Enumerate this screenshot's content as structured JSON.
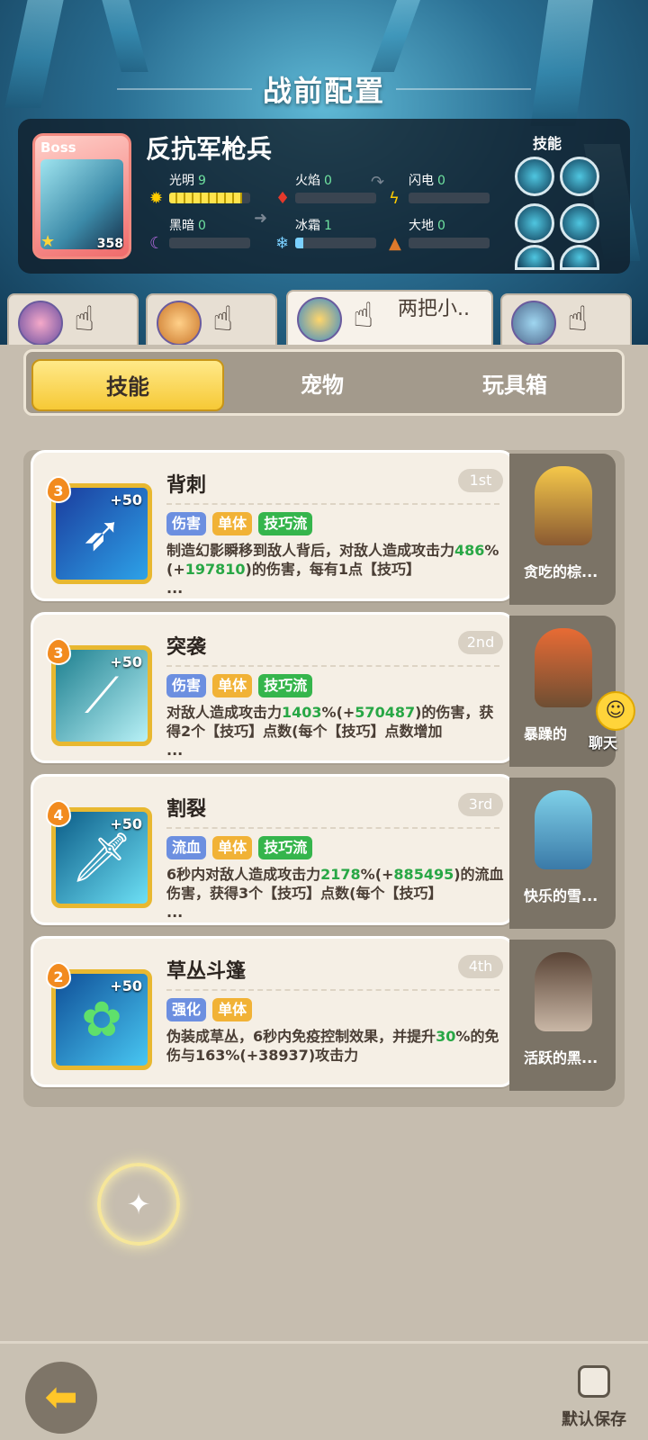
{
  "screen_title": "战前配置",
  "boss": {
    "tag": "Boss",
    "name": "反抗军枪兵",
    "level": "358",
    "elements": [
      {
        "label": "光明",
        "value": "9",
        "fill": 0.9
      },
      {
        "label": "火焰",
        "value": "0",
        "fill": 0
      },
      {
        "label": "闪电",
        "value": "0",
        "fill": 0
      },
      {
        "label": "黑暗",
        "value": "0",
        "fill": 0
      },
      {
        "label": "冰霜",
        "value": "1",
        "fill": 0.1
      },
      {
        "label": "大地",
        "value": "0",
        "fill": 0
      }
    ],
    "skills_label": "技能"
  },
  "team_tabs": [
    {
      "name": ""
    },
    {
      "name": ""
    },
    {
      "name": "两把小.."
    },
    {
      "name": ""
    }
  ],
  "segments": {
    "skill": "技能",
    "pet": "宠物",
    "toybox": "玩具箱"
  },
  "skills": [
    {
      "level": "3",
      "plus": "+50",
      "name": "背刺",
      "rank": "1st",
      "tags": [
        "伤害",
        "单体",
        "技巧流"
      ],
      "desc_a": "制造幻影瞬移到敌人背后，对敌人造成攻击力",
      "pct": "486",
      "pct_bonus": "197810",
      "desc_b": "的伤害，每有1点【技巧】",
      "more": "...",
      "pet_name": "贪吃的棕..."
    },
    {
      "level": "3",
      "plus": "+50",
      "name": "突袭",
      "rank": "2nd",
      "tags": [
        "伤害",
        "单体",
        "技巧流"
      ],
      "desc_a": "对敌人造成攻击力",
      "pct": "1403",
      "pct_bonus": "570487",
      "desc_b": "的伤害，获得2个【技巧】点数(每个【技巧】点数增加",
      "more": "...",
      "pet_name": "暴躁的"
    },
    {
      "level": "4",
      "plus": "+50",
      "name": "割裂",
      "rank": "3rd",
      "tags": [
        "流血",
        "单体",
        "技巧流"
      ],
      "desc_a": "6秒内对敌人造成攻击力",
      "pct": "2178",
      "pct_bonus": "885495",
      "desc_b": "的流血伤害，获得3个【技巧】点数(每个【技巧】",
      "more": "...",
      "pet_name": "快乐的雪..."
    },
    {
      "level": "2",
      "plus": "+50",
      "name": "草丛斗篷",
      "rank": "4th",
      "tags": [
        "强化",
        "单体"
      ],
      "desc_a": "伪装成草丛，6秒内免疫控制效果，并提升",
      "pct": "30",
      "pct_bonus": "",
      "desc_b": "%的免伤与163%(+38937)攻击力",
      "more": "",
      "pet_name": "活跃的黑..."
    }
  ],
  "chat_label": "聊天",
  "save_label": "默认保存",
  "colors": {
    "accent": "#f6c936",
    "green_value": "#28a745",
    "boss_red": "#f06b6b"
  }
}
